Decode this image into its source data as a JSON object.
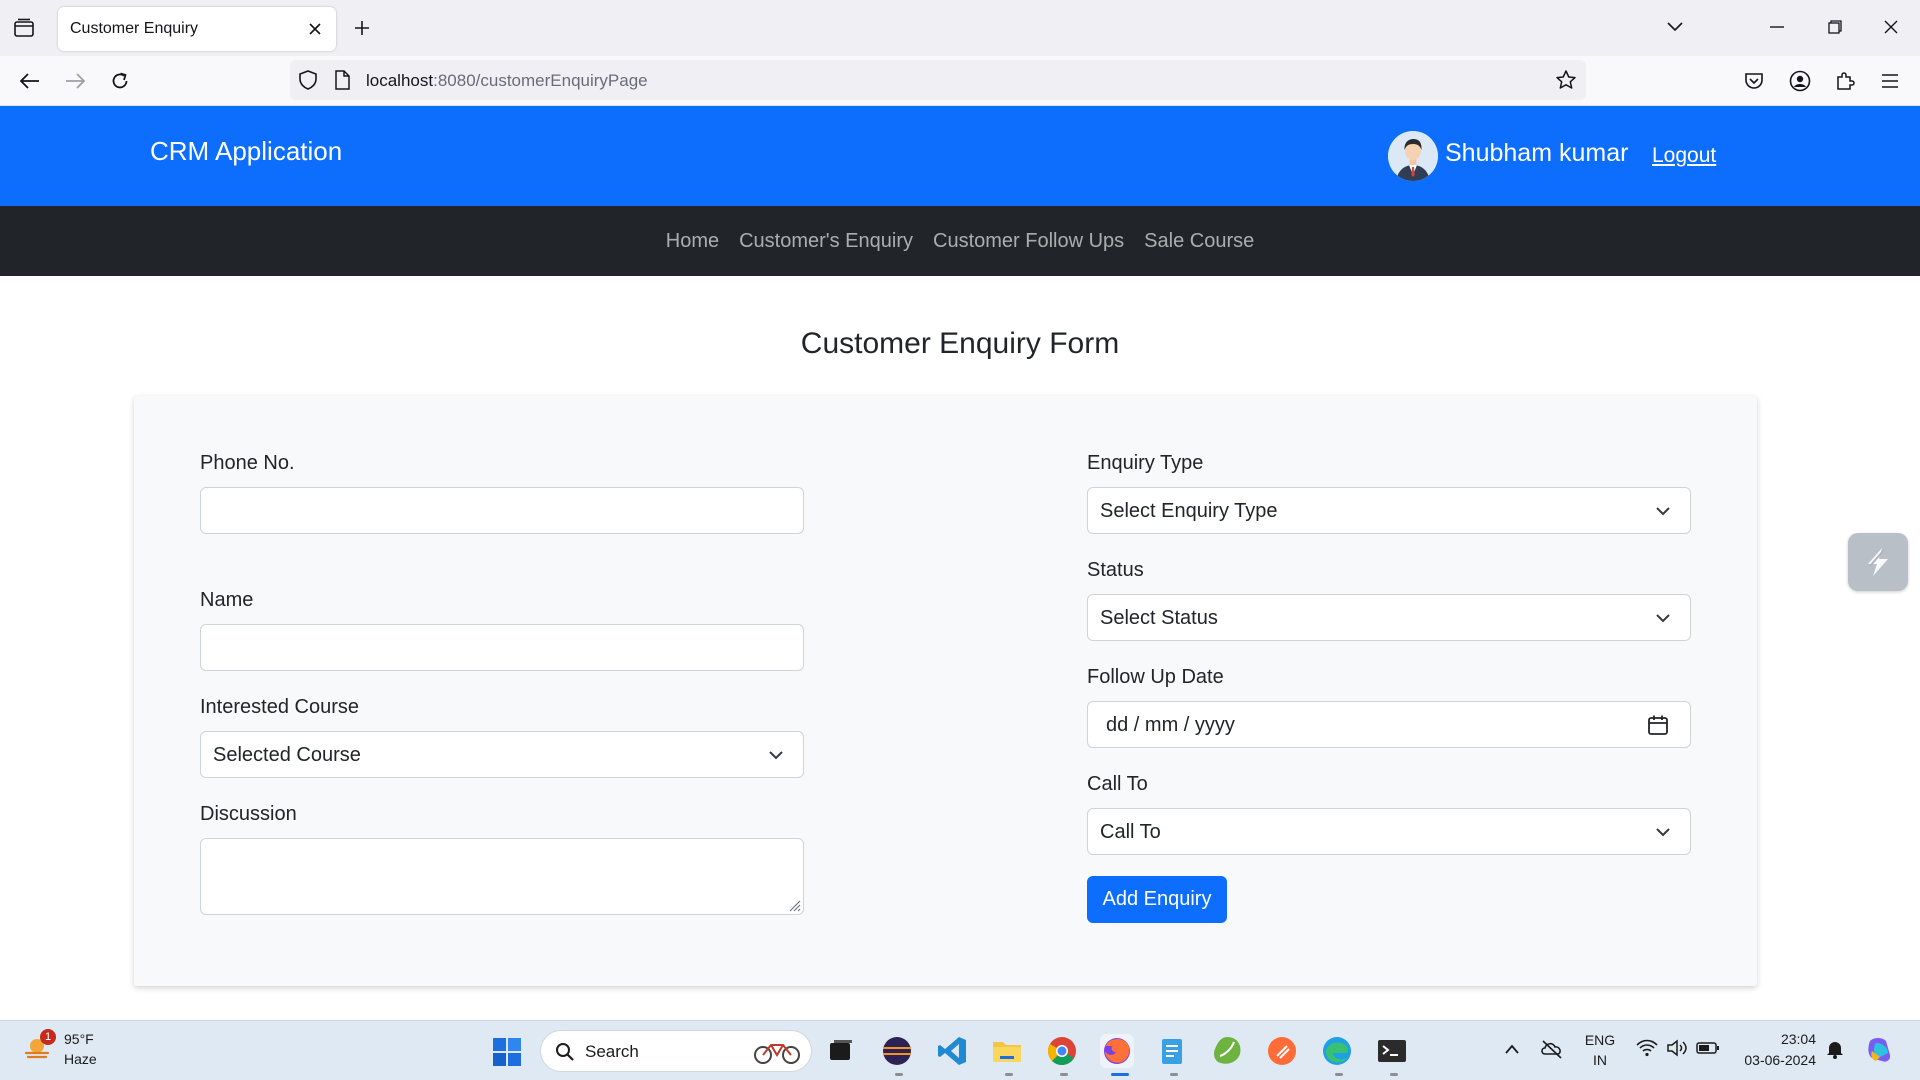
{
  "browser": {
    "tab_title": "Customer Enquiry",
    "url_host": "localhost",
    "url_rest": ":8080/customerEnquiryPage"
  },
  "header": {
    "brand": "CRM Application",
    "username": "Shubham kumar",
    "logout": "Logout",
    "accent_color": "#0d6efd"
  },
  "menu": {
    "items": [
      "Home",
      "Customer's Enquiry",
      "Customer Follow Ups",
      "Sale Course"
    ]
  },
  "form": {
    "title": "Customer Enquiry Form",
    "phone_label": "Phone No.",
    "phone_value": "",
    "name_label": "Name",
    "name_value": "",
    "course_label": "Interested Course",
    "course_value": "Selected Course",
    "discussion_label": "Discussion",
    "discussion_value": "",
    "enquiry_type_label": "Enquiry Type",
    "enquiry_type_value": "Select Enquiry Type",
    "status_label": "Status",
    "status_value": "Select Status",
    "followup_label": "Follow Up Date",
    "followup_placeholder": "dd / mm / yyyy",
    "callto_label": "Call To",
    "callto_value": "Call To",
    "submit_label": "Add Enquiry"
  },
  "taskbar": {
    "weather_temp": "95°F",
    "weather_cond": "Haze",
    "weather_badge": "1",
    "search_label": "Search",
    "lang_top": "ENG",
    "lang_bottom": "IN",
    "time": "23:04",
    "date": "03-06-2024"
  }
}
